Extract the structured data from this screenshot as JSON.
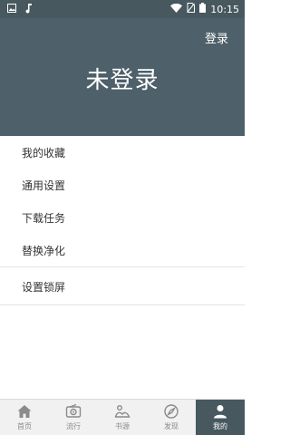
{
  "status_bar": {
    "time": "10:15",
    "icons": [
      "image-icon",
      "music-note-icon",
      "wifi-icon",
      "no-sim-icon",
      "battery-icon"
    ]
  },
  "header": {
    "login_label": "登录",
    "title": "未登录",
    "color": "#4e6069"
  },
  "menu": {
    "group1": [
      "我的收藏",
      "通用设置",
      "下载任务",
      "替换净化"
    ],
    "group2": [
      "设置锁屏"
    ]
  },
  "bottom_nav": {
    "items": [
      {
        "label": "首页",
        "icon": "home-icon"
      },
      {
        "label": "流行",
        "icon": "radio-icon"
      },
      {
        "label": "书源",
        "icon": "book-source-icon"
      },
      {
        "label": "发现",
        "icon": "compass-icon"
      },
      {
        "label": "我的",
        "icon": "person-icon"
      }
    ],
    "active_index": 4,
    "active_color": "#47585f"
  }
}
